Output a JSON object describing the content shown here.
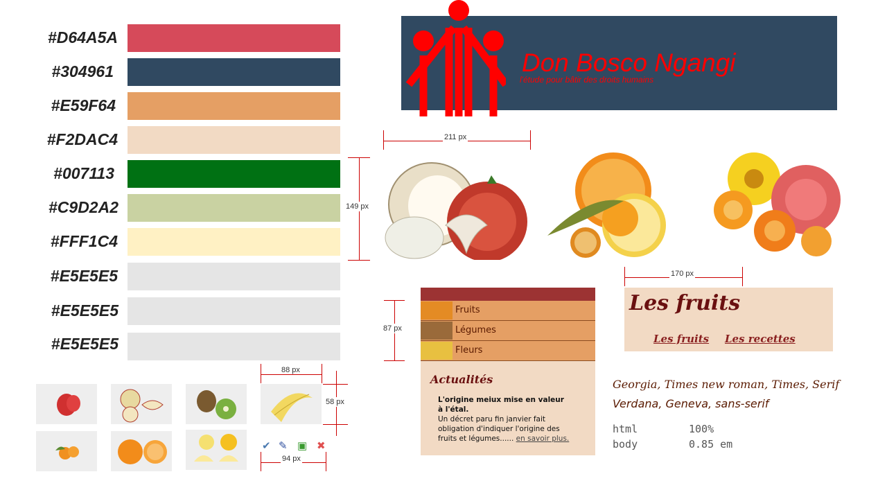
{
  "palette": [
    {
      "label": "#D64A5A",
      "color": "#D64A5A"
    },
    {
      "label": "#304961",
      "color": "#304961"
    },
    {
      "label": "#E59F64",
      "color": "#E59F64"
    },
    {
      "label": "#F2DAC4",
      "color": "#F2DAC4"
    },
    {
      "label": "#007113",
      "color": "#007113"
    },
    {
      "label": "#C9D2A2",
      "color": "#C9D2A2"
    },
    {
      "label": "#FFF1C4",
      "color": "#FFF1C4"
    },
    {
      "label": "#E5E5E5",
      "color": "#E5E5E5"
    },
    {
      "label": "#E5E5E5",
      "color": "#E5E5E5"
    },
    {
      "label": "#E5E5E5",
      "color": "#E5E5E5"
    }
  ],
  "header": {
    "title": "Don Bosco Ngangi",
    "subtitle": "l'étude pour bâtir des droits humains",
    "logo_icon": "three-figures-logo-icon"
  },
  "measurements": {
    "width_211": "211 px",
    "height_149": "149 px",
    "width_170": "170 px",
    "height_87": "87 px",
    "width_88": "88 px",
    "height_58": "58 px",
    "width_94": "94 px"
  },
  "menu": {
    "items": [
      {
        "label": "Fruits"
      },
      {
        "label": "Légumes"
      },
      {
        "label": "Fleurs"
      }
    ],
    "news_title": "Actualités",
    "news_headline": "L'origine meiux mise en valeur à l'étal.",
    "news_text": "Un décret paru fin janvier fait obligation d'indiquer l'origine des fruits et légumes......",
    "news_link": "en savoir plus."
  },
  "fruits_block": {
    "title": "Les fruits",
    "links": [
      "Les fruits",
      "Les recettes"
    ]
  },
  "typography": {
    "serif_stack": "Georgia, Times new roman, Times, Serif",
    "sans_stack": "Verdana, Geneva, sans-serif",
    "html_label": "html",
    "html_value": "100%",
    "body_label": "body",
    "body_value": "0.85 em"
  },
  "icons": [
    "check-icon",
    "pencil-icon",
    "box-icon",
    "close-icon"
  ]
}
